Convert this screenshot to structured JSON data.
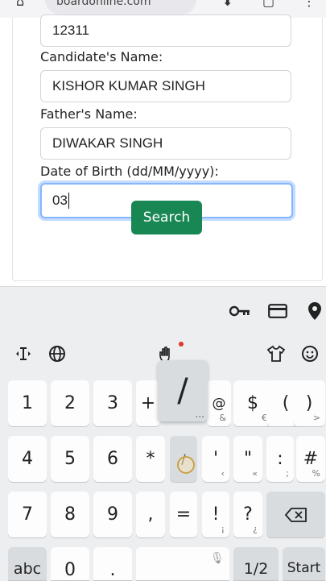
{
  "browser": {
    "url": "boardonline.com"
  },
  "form": {
    "roll_value": "12311",
    "candidate_label": "Candidate's Name:",
    "candidate_value": "KISHOR KUMAR SINGH",
    "father_label": "Father's Name:",
    "father_value": "DIWAKAR SINGH",
    "dob_label": "Date of Birth (dd/MM/yyyy):",
    "dob_value": "03",
    "search_label": "Search"
  },
  "keyboard": {
    "popup_char": "/",
    "popup_more": "...",
    "rows": [
      [
        {
          "k": "1"
        },
        {
          "k": "2"
        },
        {
          "k": "3"
        },
        {
          "k": "+"
        },
        {
          "k": "/"
        },
        {
          "k": "@",
          "s": "&"
        },
        {
          "k": "$",
          "s": "€"
        },
        {
          "k": "(",
          "s": "<"
        },
        {
          "k": ")",
          "s": ">"
        }
      ],
      [
        {
          "k": "4"
        },
        {
          "k": "5"
        },
        {
          "k": "6"
        },
        {
          "k": "*"
        },
        {
          "k": "/"
        },
        {
          "k": "'",
          "s": "‹"
        },
        {
          "k": "\"",
          "s": "«"
        },
        {
          "k": ":",
          "s": ";"
        },
        {
          "k": "#",
          "s": "%"
        }
      ],
      [
        {
          "k": "7"
        },
        {
          "k": "8"
        },
        {
          "k": "9"
        },
        {
          "k": ","
        },
        {
          "k": "="
        },
        {
          "k": "!",
          "s": "¡"
        },
        {
          "k": "?",
          "s": "¿"
        }
      ],
      [
        {
          "k": "abc"
        },
        {
          "k": "0"
        },
        {
          "k": "."
        },
        {
          "k": "1/2"
        },
        {
          "k": "Start"
        }
      ]
    ]
  }
}
